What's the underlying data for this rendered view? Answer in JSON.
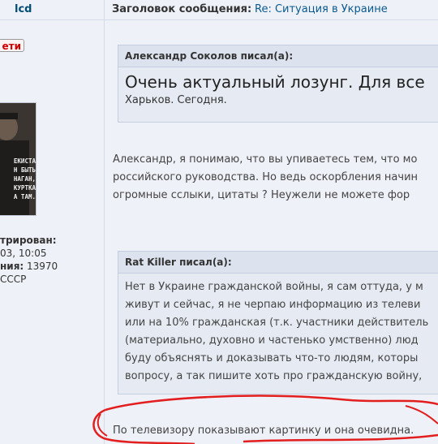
{
  "header": {
    "username": "lcd",
    "subject_label": "Заголовок сообщения:",
    "subject_link": "Re: Ситуация в Украине"
  },
  "sidebar": {
    "status_button": "ети",
    "avatar_lines": [
      "ЕКИСТА",
      "Н БЫТЬ",
      "НАГАН,",
      "КУРТКА",
      "А ТАМ."
    ],
    "info_lines": [
      {
        "text": "трирован:",
        "bold": true
      },
      {
        "text": "03, 10:05",
        "bold": false
      },
      {
        "label": "ния:",
        "value": " 13970"
      },
      {
        "text": "СССР",
        "bold": false
      }
    ]
  },
  "quote1": {
    "author": "Александр Соколов писал(а):",
    "big_text": "Очень актуальный лозунг. Для все",
    "small_text": "Харьков. Сегодня."
  },
  "reply_paragraph": [
    "Александр, я понимаю, что вы упиваетесь тем, что мо",
    "российского руководства. Но ведь оскорбления начин",
    "огромные сслыки, цитаты ? Неужели не можете фор"
  ],
  "quote2": {
    "author": "Rat Killer писал(а):",
    "lines": [
      "Нет в Украине гражданской войны, я сам оттуда, у м",
      "живут и сейчас, я не черпаю информацию из телеви",
      "или на 10% гражданская (т.к. участники действитель",
      "(материально, духовно и частенько умственно) люд",
      "буду объяснять и доказывать что-то людям, которы",
      "вопросу, а так пишите хоть про гражданскую войну,"
    ]
  },
  "final_line": "По телевизору показывают картинку и она очевидна.",
  "colors": {
    "link": "#0a5a8f",
    "status_red": "#cc0000",
    "scribble_red": "#e31e1e",
    "background": "#eef1f7"
  }
}
